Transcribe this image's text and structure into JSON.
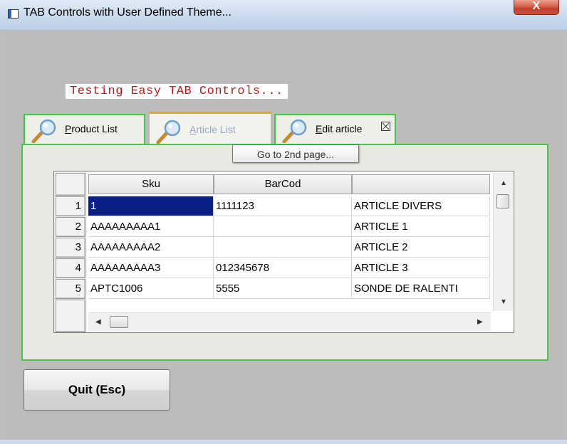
{
  "window": {
    "title": "TAB Controls with User Defined Theme...",
    "close_glyph": "X"
  },
  "caption": "Testing Easy TAB Controls...",
  "tabs": [
    {
      "prefix": "",
      "accel": "P",
      "rest": "roduct List",
      "icon": "magnifier-icon",
      "active": false
    },
    {
      "prefix": "",
      "accel": "A",
      "rest": "rticle List",
      "icon": "magnifier-icon",
      "active": true
    },
    {
      "prefix": "",
      "accel": "E",
      "rest": "dit article",
      "icon": "magnifier-icon",
      "active": false,
      "closable": true
    }
  ],
  "tooltip": "Go to 2nd page...",
  "grid": {
    "columns": [
      "Sku",
      "BarCod",
      ""
    ],
    "rows": [
      {
        "num": "1",
        "cells": [
          "1",
          "1111123",
          "ARTICLE DIVERS"
        ]
      },
      {
        "num": "2",
        "cells": [
          "AAAAAAAAA1",
          "",
          "ARTICLE 1"
        ]
      },
      {
        "num": "3",
        "cells": [
          "AAAAAAAAA2",
          "",
          "ARTICLE 2"
        ]
      },
      {
        "num": "4",
        "cells": [
          "AAAAAAAAA3",
          "012345678",
          "ARTICLE 3"
        ]
      },
      {
        "num": "5",
        "cells": [
          "APTC1006",
          "5555",
          "SONDE DE RALENTI"
        ]
      }
    ],
    "scroll_up_glyph": "▲",
    "scroll_down_glyph": "▼",
    "scroll_left_glyph": "◀",
    "scroll_right_glyph": "▶"
  },
  "quit_button": "Quit (Esc)",
  "colors": {
    "tab_border": "#46c846",
    "selection": "#0a1f86",
    "caption_text": "#b81c1c"
  }
}
